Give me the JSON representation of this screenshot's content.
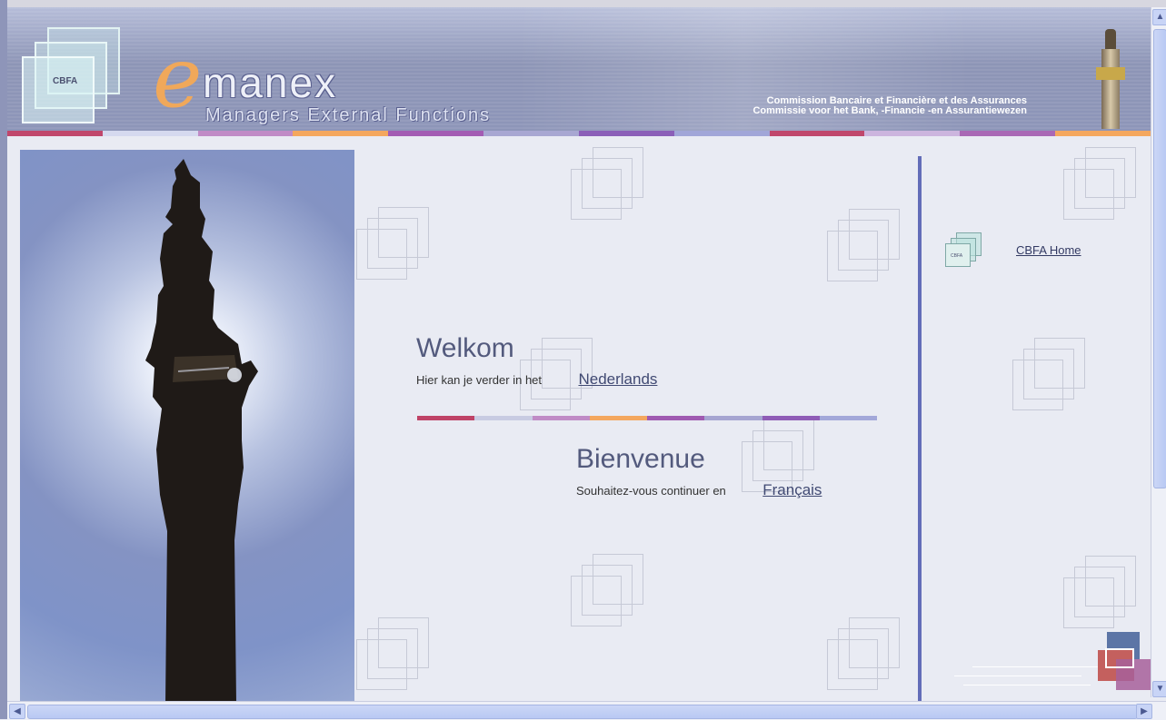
{
  "header": {
    "logo_badge": "CBFA",
    "logo_e": "e",
    "logo_word": "manex",
    "logo_subtitle": "Managers External Functions",
    "commission_fr": "Commission Bancaire et Financière et des Assurances",
    "commission_nl": "Commissie voor het Bank, -Financie -en Assurantiewezen",
    "color_stripes": [
      "#c0476c",
      "#d5d9ef",
      "#c08bc6",
      "#f4a75e",
      "#a35cb3",
      "#a8a7d2",
      "#8b5fb8",
      "#a1a6d8",
      "#c0476c",
      "#ccb5de",
      "#a968b5",
      "#f4a75e"
    ]
  },
  "main": {
    "welcome_nl": {
      "heading": "Welkom",
      "text": "Hier kan je verder in het",
      "link": "Nederlands"
    },
    "welcome_fr": {
      "heading": "Bienvenue",
      "text": "Souhaitez-vous continuer en",
      "link": "Français"
    },
    "divider_colors": [
      "#bf4266",
      "#c8cbe2",
      "#c08bc6",
      "#f4a75e",
      "#9f5ab1",
      "#a6a5d1",
      "#8f5cb6",
      "#a3a8d9"
    ]
  },
  "sidebar": {
    "home_icon_text": "CBFA",
    "home_link": "CBFA Home"
  },
  "colors": {
    "background": "#e9ebf3",
    "accent_line": "#636db8",
    "header": "#8d95b6"
  }
}
